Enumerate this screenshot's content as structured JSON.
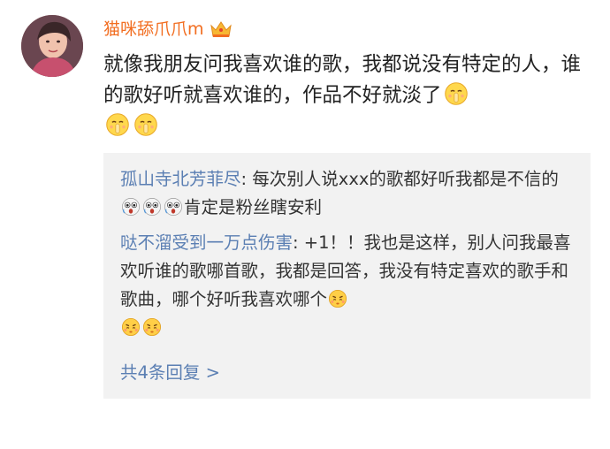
{
  "post": {
    "username": "猫咪舔爪爪m",
    "badge_icon": "crown-badge-icon",
    "text": "就像我朋友问我喜欢谁的歌，我都说没有特定的人，谁的歌好听就喜欢谁的，作品不好就淡了",
    "trailing_emojis": [
      "shush-emoji",
      "shush-emoji",
      "shush-emoji"
    ]
  },
  "replies": [
    {
      "author": "孤山寺北芳菲尽",
      "separator": ": ",
      "text_before": "每次别人说xxx的歌都好听我都是不信的",
      "emojis": [
        "shocked-emoji",
        "shocked-emoji",
        "shocked-emoji"
      ],
      "text_after": "肯定是粉丝瞎安利"
    },
    {
      "author": "哒不溜受到一万点伤害",
      "separator": ": ",
      "text": "+1！！我也是这样，别人问我最喜欢听谁的歌哪首歌，我都是回答，我没有特定喜欢的歌手和歌曲，哪个好听我喜欢哪个",
      "emojis": [
        "pouting-emoji",
        "pouting-emoji",
        "pouting-emoji"
      ]
    }
  ],
  "more_replies_label": "共4条回复 >",
  "colors": {
    "username": "#f26e21",
    "link": "#5b7fb3",
    "body_text": "#222222",
    "reply_bg": "#f2f2f2"
  }
}
